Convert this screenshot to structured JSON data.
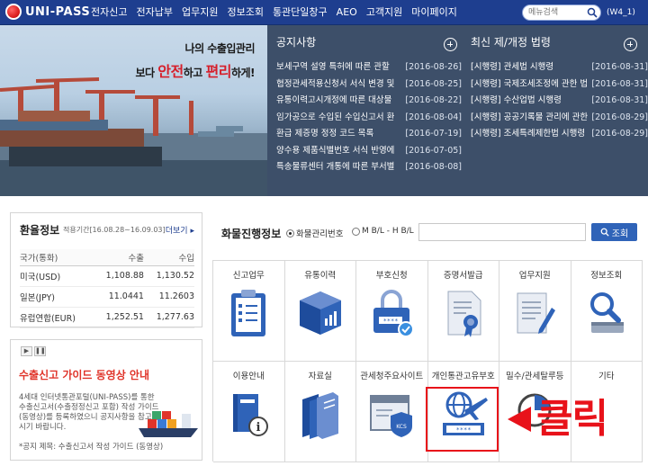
{
  "topbar": {
    "logo_text": "UNI-PASS",
    "nav": [
      "전자신고",
      "전자납부",
      "업무지원",
      "정보조회",
      "통관단일창구",
      "AEO",
      "고객지원",
      "마이페이지"
    ],
    "search_placeholder": "메뉴검색",
    "user": "(W4_1)"
  },
  "banner": {
    "line1": "나의 수출입관리",
    "line2_a": "보다 ",
    "line2_b": "안전",
    "line2_c": "하고 ",
    "line2_d": "편리",
    "line2_e": "하게!"
  },
  "notices": {
    "title": "공지사항",
    "items": [
      {
        "title": "보세구역 설영 특허에 따른 관할",
        "date": "[2016-08-26]"
      },
      {
        "title": "협정관세적용신청서 서식 변경 및",
        "date": "[2016-08-25]"
      },
      {
        "title": "유통이력고시개정에 따른 대상물",
        "date": "[2016-08-22]"
      },
      {
        "title": "임가공으로 수입된 수입신고서 환",
        "date": "[2016-08-04]"
      },
      {
        "title": "환급 제증명 정정 코드 목록",
        "date": "[2016-07-19]"
      },
      {
        "title": "양수용 제품식별번호 서식 반영에",
        "date": "[2016-07-05]"
      },
      {
        "title": "특송물류센터 개통에 따른 부서별",
        "date": "[2016-08-08]"
      }
    ]
  },
  "laws": {
    "title": "최신 제/개정 법령",
    "items": [
      {
        "title": "[시행령] 관세법 시행령",
        "date": "[2016-08-31]"
      },
      {
        "title": "[시행령] 국제조세조정에 관한 법",
        "date": "[2016-08-31]"
      },
      {
        "title": "[시행령] 수산업법 시행령",
        "date": "[2016-08-31]"
      },
      {
        "title": "[시행령] 공공기록물 관리에 관한",
        "date": "[2016-08-29]"
      },
      {
        "title": "[시행령] 조세특례제한법 시행령",
        "date": "[2016-08-29]"
      }
    ]
  },
  "exchange": {
    "title": "환율정보",
    "period": "적용기간[16.08.28~16.09.03]",
    "more": "더보기",
    "headers": [
      "국가(통화)",
      "수출",
      "수입"
    ],
    "rows": [
      [
        "미국(USD)",
        "1,108.88",
        "1,130.52"
      ],
      [
        "일본(JPY)",
        "11.0441",
        "11.2603"
      ],
      [
        "유럽연합(EUR)",
        "1,252.51",
        "1,277.63"
      ]
    ]
  },
  "guide": {
    "title": "수출신고 가이드 동영상 안내",
    "text": "4세대 인터넷통관포털(UNI-PASS)를 통한 수출신고서(수출정정신고 포함) 작성 가이드(동영상)를 등록하였으니 공지사항을 참고하시기 바랍니다.",
    "note": "*공지 제목: 수출신고서 작성 가이드 (동영상)"
  },
  "cargo": {
    "title": "화물진행정보",
    "radio1": "화물관리번호",
    "radio2": "M B/L - H B/L",
    "button": "조회"
  },
  "tiles": [
    "신고업무",
    "유통이력",
    "부호신청",
    "증명서발급",
    "업무지원",
    "정보조회",
    "이용안내",
    "자료실",
    "관세청주요사이트",
    "개인통관고유부호",
    "밀수/관세탈루등",
    "기타"
  ],
  "callout": "클릭",
  "colors": {
    "nav_bg": "#1e3e8f",
    "notice_bg": "#3d4f69",
    "highlight": "#e8121a",
    "accent": "#2f63b8"
  }
}
